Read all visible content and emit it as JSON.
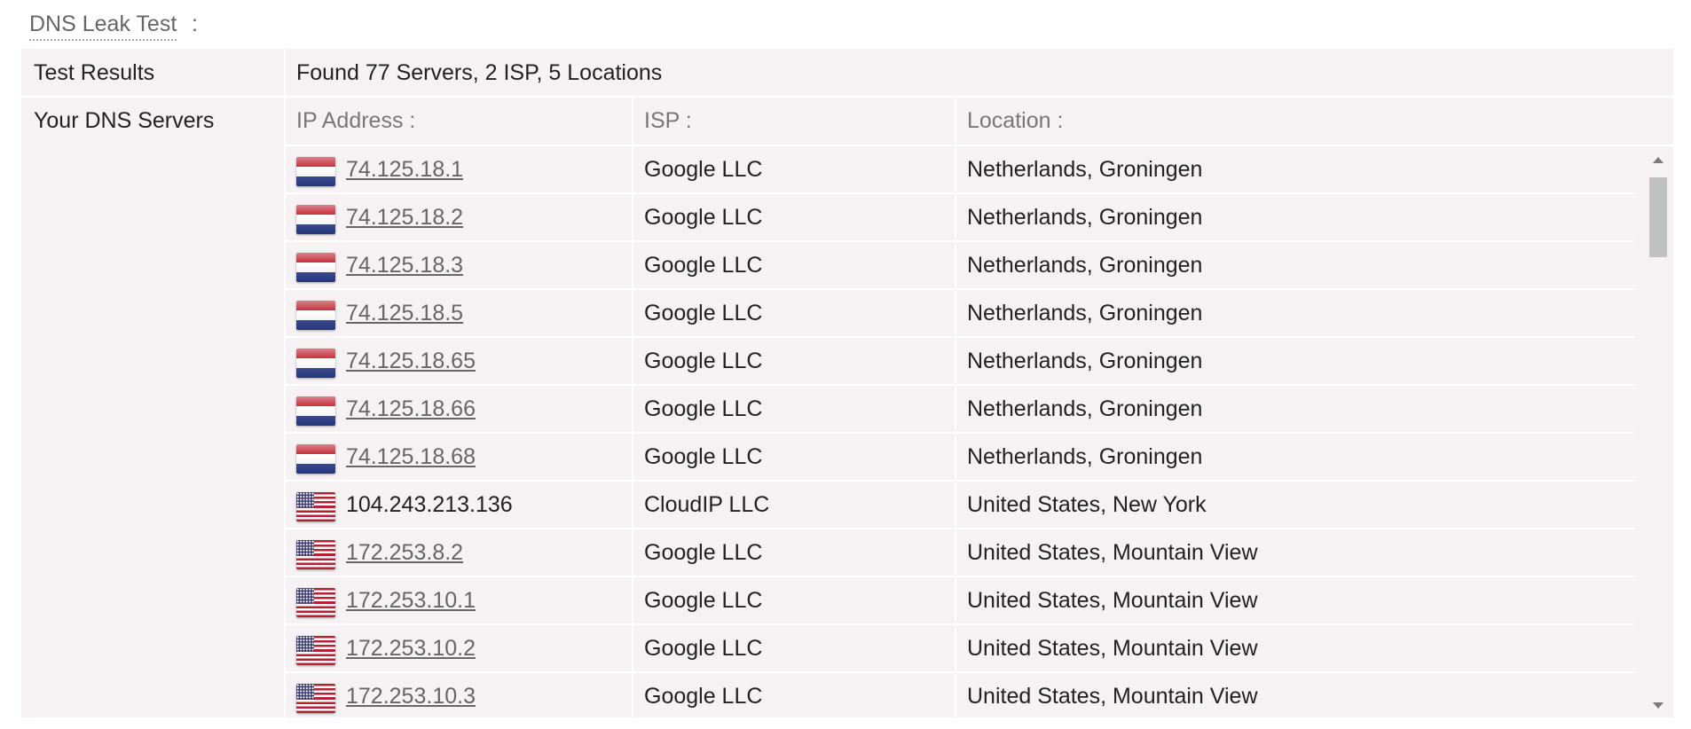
{
  "section": {
    "title": "DNS Leak Test",
    "colon": ":"
  },
  "test_results": {
    "label": "Test Results",
    "value": "Found 77 Servers, 2 ISP, 5 Locations"
  },
  "dns_servers": {
    "label": "Your DNS Servers",
    "headers": {
      "ip": "IP Address :",
      "isp": "ISP :",
      "location": "Location :"
    },
    "rows": [
      {
        "flag": "netherlands-flag-icon",
        "ip": "74.125.18.1",
        "linked": true,
        "isp": "Google LLC",
        "location": "Netherlands, Groningen"
      },
      {
        "flag": "netherlands-flag-icon",
        "ip": "74.125.18.2",
        "linked": true,
        "isp": "Google LLC",
        "location": "Netherlands, Groningen"
      },
      {
        "flag": "netherlands-flag-icon",
        "ip": "74.125.18.3",
        "linked": true,
        "isp": "Google LLC",
        "location": "Netherlands, Groningen"
      },
      {
        "flag": "netherlands-flag-icon",
        "ip": "74.125.18.5",
        "linked": true,
        "isp": "Google LLC",
        "location": "Netherlands, Groningen"
      },
      {
        "flag": "netherlands-flag-icon",
        "ip": "74.125.18.65",
        "linked": true,
        "isp": "Google LLC",
        "location": "Netherlands, Groningen"
      },
      {
        "flag": "netherlands-flag-icon",
        "ip": "74.125.18.66",
        "linked": true,
        "isp": "Google LLC",
        "location": "Netherlands, Groningen"
      },
      {
        "flag": "netherlands-flag-icon",
        "ip": "74.125.18.68",
        "linked": true,
        "isp": "Google LLC",
        "location": "Netherlands, Groningen"
      },
      {
        "flag": "united-states-flag-icon",
        "ip": "104.243.213.136",
        "linked": false,
        "isp": "CloudIP LLC",
        "location": "United States, New York"
      },
      {
        "flag": "united-states-flag-icon",
        "ip": "172.253.8.2",
        "linked": true,
        "isp": "Google LLC",
        "location": "United States, Mountain View"
      },
      {
        "flag": "united-states-flag-icon",
        "ip": "172.253.10.1",
        "linked": true,
        "isp": "Google LLC",
        "location": "United States, Mountain View"
      },
      {
        "flag": "united-states-flag-icon",
        "ip": "172.253.10.2",
        "linked": true,
        "isp": "Google LLC",
        "location": "United States, Mountain View"
      },
      {
        "flag": "united-states-flag-icon",
        "ip": "172.253.10.3",
        "linked": true,
        "isp": "Google LLC",
        "location": "United States, Mountain View"
      }
    ]
  },
  "scrollbar": {
    "up_icon": "scroll-up-arrow-icon",
    "down_icon": "scroll-down-arrow-icon"
  },
  "colors": {
    "table_background": "#f6f1f3",
    "link_text": "#666666",
    "header_text": "#777777",
    "body_text": "#222222"
  }
}
